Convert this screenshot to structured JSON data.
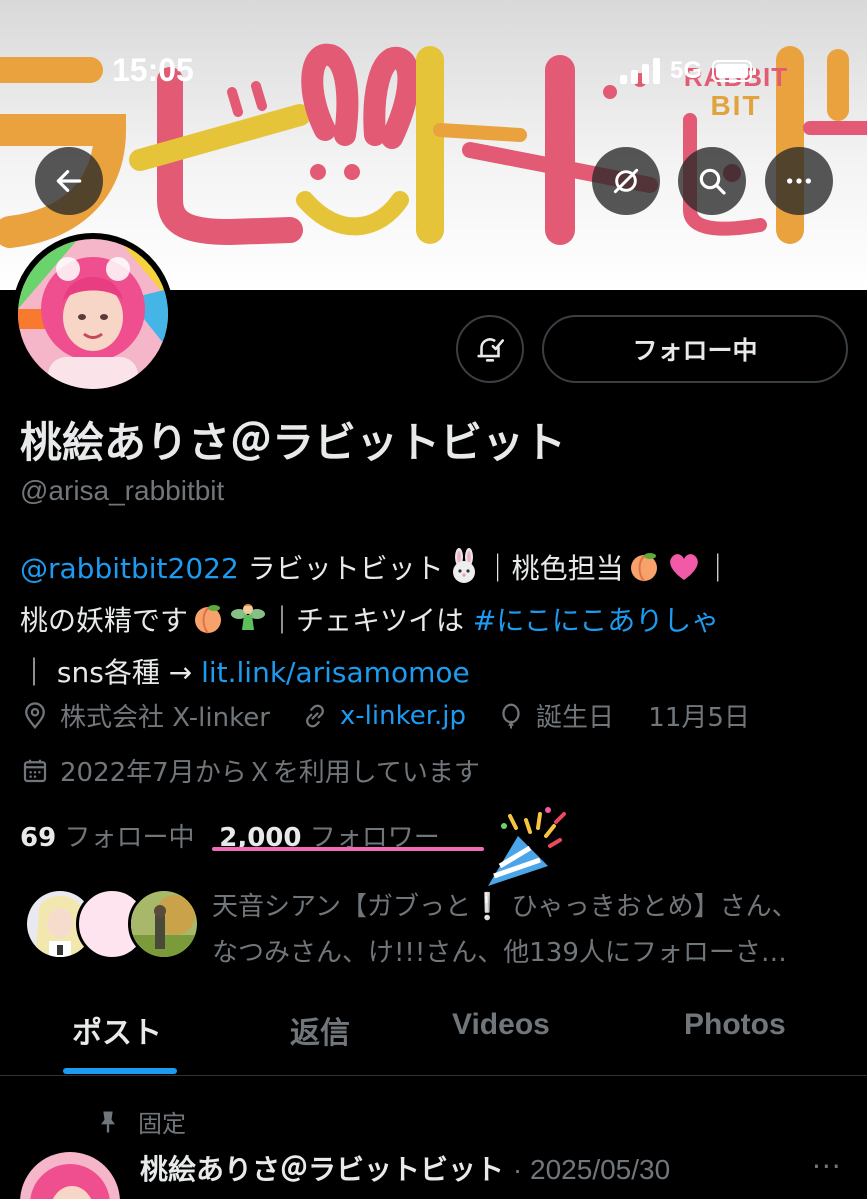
{
  "status_bar": {
    "time": "15:05",
    "network": "5G"
  },
  "banner": {
    "logo_line1": "RABBIT",
    "logo_line2": "BIT"
  },
  "nav": {
    "back_icon": "arrow-left-icon",
    "mute_icon": "slash-circle-icon",
    "search_icon": "search-icon",
    "more_icon": "more-horizontal-icon"
  },
  "profile": {
    "follow_button_label": "フォロー中",
    "display_name": "桃絵ありさ＠ラビットビット",
    "handle": "@arisa_rabbitbit",
    "bio": {
      "mention": "@rabbitbit2022",
      "part1": " ラビットビット",
      "part2": "｜桃色担当",
      "part3": "｜",
      "part4": "桃の妖精です",
      "part5": "｜チェキツイは ",
      "hashtag": "#にこにこありしゃ",
      "part6": "｜ sns各種 → ",
      "link": "lit.link/arisamomoe"
    },
    "meta": {
      "company": "株式会社 X-linker",
      "website": "x-linker.jp",
      "birthday": "誕生日　 11月5日",
      "joined": "2022年7月からＸを利用しています"
    },
    "stats": {
      "following_count": "69",
      "following_label": " フォロー中",
      "followers_count": "2,000",
      "followers_label": " フォロワー"
    },
    "known_followers": {
      "line1": "天音シアン【ガブっと❕ ひゃっきおとめ】さん、",
      "line2": "なつみさん、け!!!さん、他139人にフォローさ…"
    }
  },
  "tabs": [
    {
      "label": "ポスト",
      "active": true
    },
    {
      "label": "返信",
      "active": false
    },
    {
      "label": "Videos",
      "active": false
    },
    {
      "label": "Photos",
      "active": false
    }
  ],
  "pinned_post": {
    "pinned_label": "固定",
    "author": "桃絵ありさ＠ラビットビット",
    "date": "· 2025/05/30",
    "more": "···"
  },
  "colors": {
    "accent": "#1d9bf0",
    "muted": "#71767b",
    "text": "#e7e9ea",
    "highlight_underline": "#f06ab6"
  }
}
